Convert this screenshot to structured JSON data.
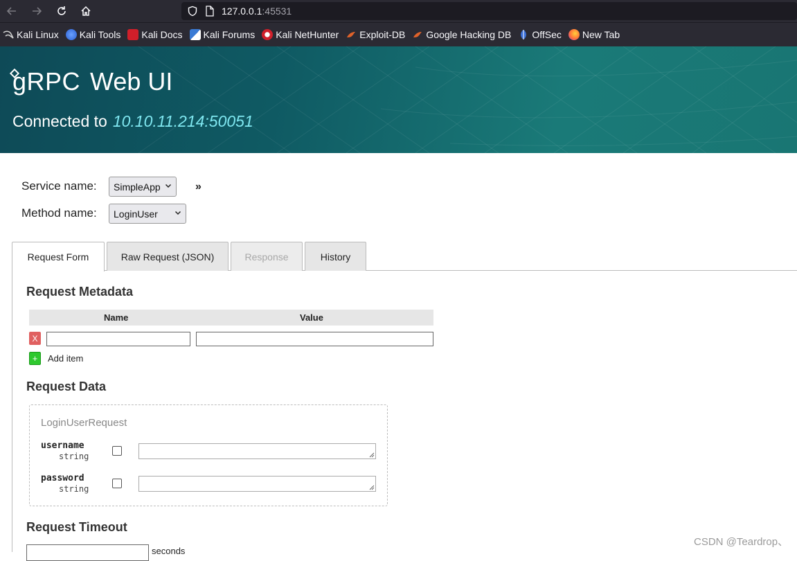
{
  "browser": {
    "url_host": "127.0.0.1",
    "url_port": ":45531",
    "bookmarks": [
      {
        "label": "Kali Linux",
        "icon": "kali-dragon-icon"
      },
      {
        "label": "Kali Tools",
        "icon": "kali-tools-icon"
      },
      {
        "label": "Kali Docs",
        "icon": "kali-docs-icon"
      },
      {
        "label": "Kali Forums",
        "icon": "kali-forums-icon"
      },
      {
        "label": "Kali NetHunter",
        "icon": "nethunter-icon"
      },
      {
        "label": "Exploit-DB",
        "icon": "exploit-db-icon"
      },
      {
        "label": "Google Hacking DB",
        "icon": "ghdb-icon"
      },
      {
        "label": "OffSec",
        "icon": "offsec-icon"
      },
      {
        "label": "New Tab",
        "icon": "firefox-icon"
      }
    ]
  },
  "header": {
    "brand": "gRPC",
    "title": "Web UI",
    "connected_label": "Connected to",
    "address": "10.10.11.214:50051"
  },
  "selectors": {
    "service_label": "Service name:",
    "service_value": "SimpleApp",
    "method_label": "Method name:",
    "method_value": "LoginUser",
    "expand_glyph": "»"
  },
  "tabs": [
    {
      "label": "Request Form",
      "state": "active"
    },
    {
      "label": "Raw Request (JSON)",
      "state": "normal"
    },
    {
      "label": "Response",
      "state": "disabled"
    },
    {
      "label": "History",
      "state": "normal"
    }
  ],
  "metadata": {
    "heading": "Request Metadata",
    "col_name": "Name",
    "col_value": "Value",
    "remove_label": "X",
    "add_glyph": "+",
    "add_label": "Add item"
  },
  "request_data": {
    "heading": "Request Data",
    "message_name": "LoginUserRequest",
    "fields": [
      {
        "name": "username",
        "type": "string"
      },
      {
        "name": "password",
        "type": "string"
      }
    ]
  },
  "timeout": {
    "heading": "Request Timeout",
    "unit": "seconds"
  },
  "watermark": "CSDN @Teardrop、",
  "colors": {
    "chrome_bg": "#2b2a33",
    "hero_start": "#0e4a57",
    "hero_end": "#197673",
    "address_accent": "#7fe7f0",
    "remove_btn": "#e06060",
    "add_btn": "#2ec82e"
  }
}
